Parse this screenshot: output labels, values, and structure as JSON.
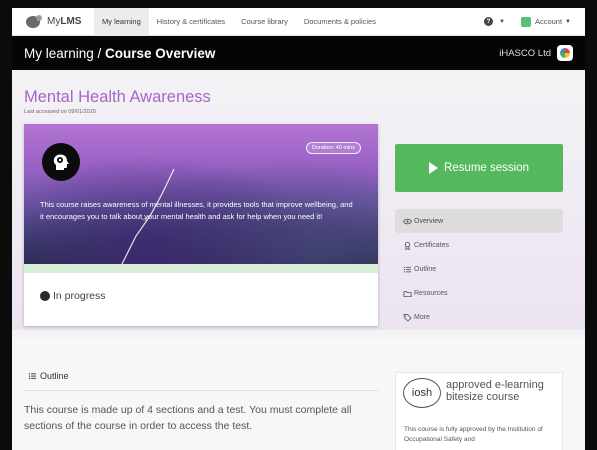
{
  "nav": {
    "brand_prefix": "My",
    "brand_bold": "LMS",
    "items": [
      {
        "label": "My learning",
        "active": true
      },
      {
        "label": "History & certificates"
      },
      {
        "label": "Course library"
      },
      {
        "label": "Documents & policies"
      }
    ],
    "help_icon": "question-circle-icon",
    "account_label": "Account"
  },
  "header": {
    "title_prefix": "My learning / ",
    "title_bold": "Course Overview",
    "org_name": "iHASCO Ltd"
  },
  "course": {
    "title": "Mental Health Awareness",
    "last_accessed": "Last accessed on 09/01/2020",
    "duration": "Duration: 40 mins",
    "description": "This course raises awareness of mental illnesses, it provides tools that improve wellbeing, and it encourages you to talk about your mental health and ask for help when you need it!",
    "status": "In progress",
    "icon": "head-brain-icon"
  },
  "actions": {
    "resume_label": "Resume session"
  },
  "side_menu": [
    {
      "label": "Overview",
      "icon": "eye-icon",
      "active": true
    },
    {
      "label": "Certificates",
      "icon": "certificate-icon"
    },
    {
      "label": "Outline",
      "icon": "list-icon"
    },
    {
      "label": "Resources",
      "icon": "folder-icon"
    },
    {
      "label": "More",
      "icon": "tag-icon"
    }
  ],
  "outline": {
    "heading": "Outline",
    "text": "This course is made up of 4 sections and a test. You must complete all sections of the course in order to access the test."
  },
  "iosh": {
    "logo": "iosh",
    "tag_line1": "approved e-learning",
    "tag_line2": "bitesize course",
    "text": "This course is fully approved by the Institution of Occupational Safety and"
  },
  "colors": {
    "accent": "#a765c9",
    "resume": "#56b85d",
    "header_bg": "#050505"
  }
}
